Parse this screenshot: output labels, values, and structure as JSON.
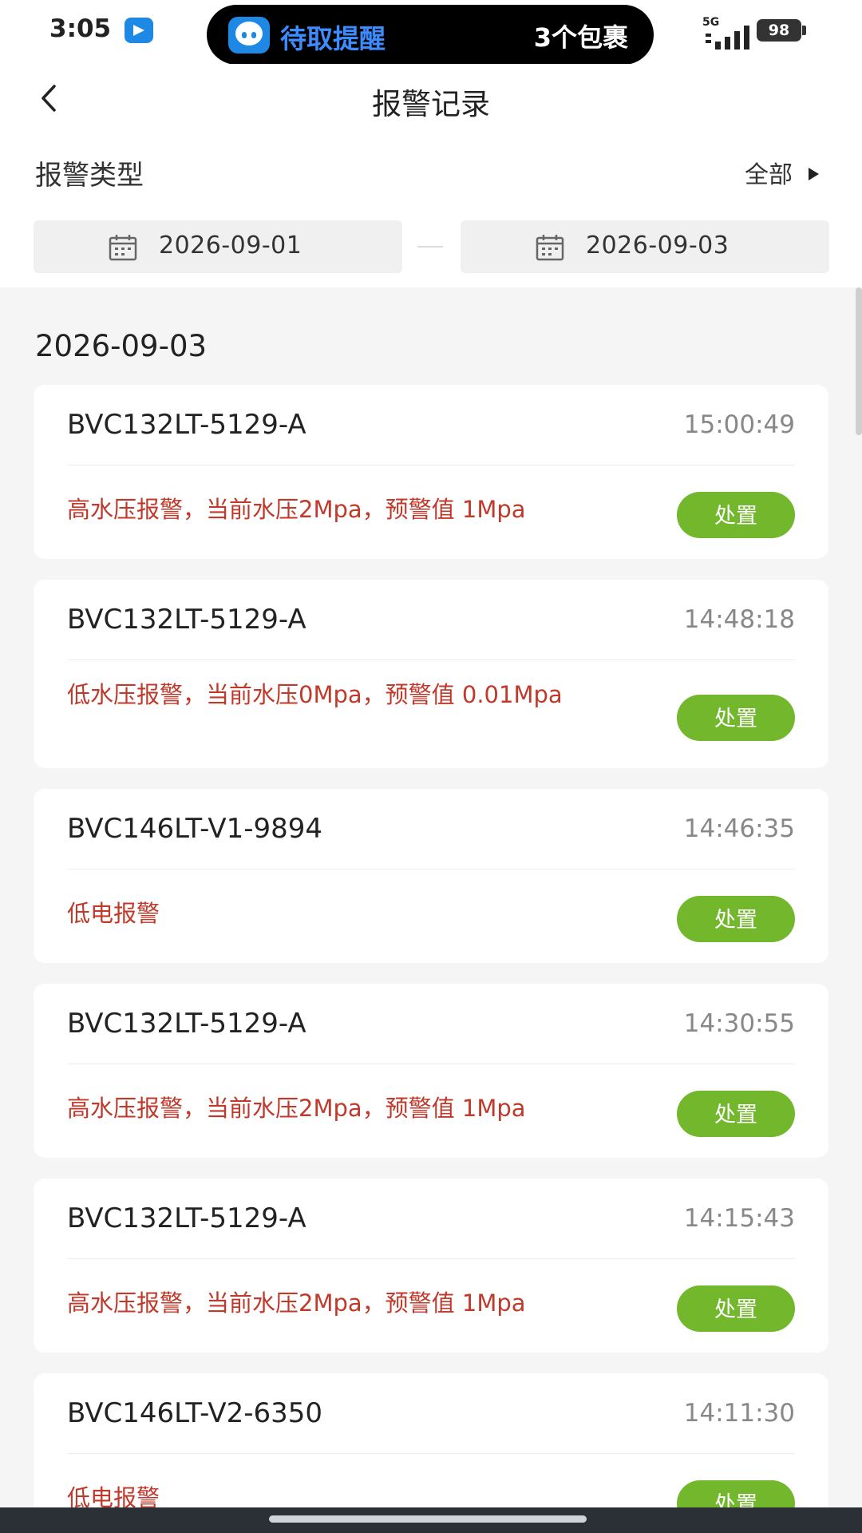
{
  "status_bar": {
    "time": "3:05",
    "notification_title": "待取提醒",
    "notification_detail": "3个包裹",
    "network": "5G",
    "battery": "98"
  },
  "nav": {
    "title": "报警记录"
  },
  "filter": {
    "type_label": "报警类型",
    "type_value": "全部",
    "start_date": "2026-09-01",
    "end_date": "2026-09-03"
  },
  "group": {
    "date": "2026-09-03"
  },
  "records": [
    {
      "device": "BVC132LT-5129-A",
      "time": "15:00:49",
      "message": "高水压报警，当前水压2Mpa，预警值 1Mpa",
      "action": "处置"
    },
    {
      "device": "BVC132LT-5129-A",
      "time": "14:48:18",
      "message": "低水压报警，当前水压0Mpa，预警值 0.01Mpa",
      "action": "处置"
    },
    {
      "device": "BVC146LT-V1-9894",
      "time": "14:46:35",
      "message": "低电报警",
      "action": "处置"
    },
    {
      "device": "BVC132LT-5129-A",
      "time": "14:30:55",
      "message": "高水压报警，当前水压2Mpa，预警值 1Mpa",
      "action": "处置"
    },
    {
      "device": "BVC132LT-5129-A",
      "time": "14:15:43",
      "message": "高水压报警，当前水压2Mpa，预警值 1Mpa",
      "action": "处置"
    },
    {
      "device": "BVC146LT-V2-6350",
      "time": "14:11:30",
      "message": "低电报警",
      "action": "处置"
    }
  ],
  "colors": {
    "alarm_text": "#c0392b",
    "action_button": "#72b72c",
    "page_background": "#f5f5f5"
  }
}
